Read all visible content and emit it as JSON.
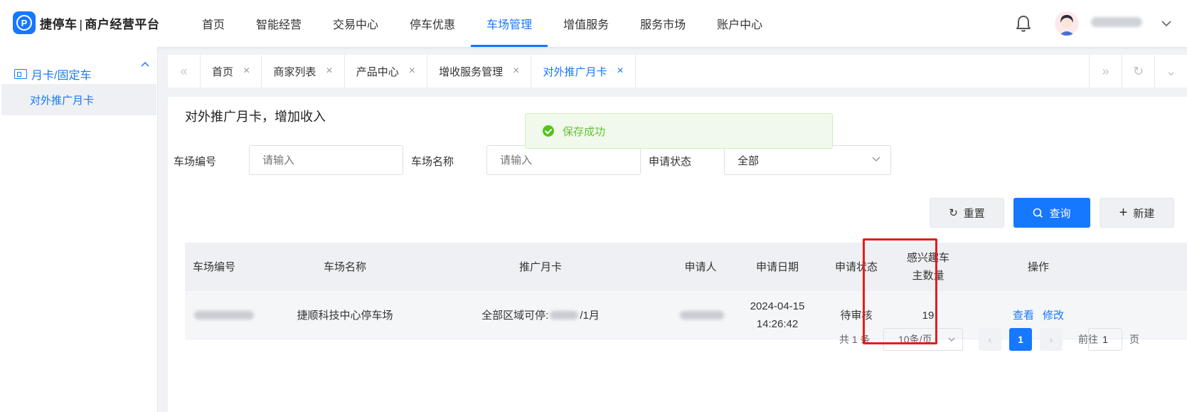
{
  "app": {
    "name": "捷停车",
    "subtitle": "商户经营平台",
    "separator": "|"
  },
  "nav": [
    {
      "label": "首页"
    },
    {
      "label": "智能经营"
    },
    {
      "label": "交易中心"
    },
    {
      "label": "停车优惠"
    },
    {
      "label": "车场管理",
      "active": true
    },
    {
      "label": "增值服务"
    },
    {
      "label": "服务市场"
    },
    {
      "label": "账户中心"
    }
  ],
  "sidebar": {
    "group": {
      "label": "月卡/固定车",
      "icon": "card-icon"
    },
    "items": [
      {
        "label": "对外推广月卡",
        "active": true
      }
    ]
  },
  "tabs": [
    {
      "label": "首页"
    },
    {
      "label": "商家列表"
    },
    {
      "label": "产品中心"
    },
    {
      "label": "增收服务管理"
    },
    {
      "label": "对外推广月卡",
      "active": true
    }
  ],
  "tab_close_glyph": "×",
  "toast": {
    "message": "保存成功",
    "type": "success",
    "color": "#67c23a"
  },
  "page": {
    "title": "对外推广月卡，增加收入"
  },
  "filters": {
    "park_code": {
      "label": "车场编号",
      "placeholder": "请输入"
    },
    "park_name": {
      "label": "车场名称",
      "placeholder": "请输入"
    },
    "status": {
      "label": "申请状态",
      "value": "全部"
    }
  },
  "buttons": {
    "reset": "重置",
    "query": "查询",
    "create": "新建"
  },
  "table": {
    "headers": [
      "车场编号",
      "车场名称",
      "推广月卡",
      "申请人",
      "申请日期",
      "申请状态",
      "感兴趣车主数量",
      "操作"
    ],
    "header_interest_lines": [
      "感兴趣车",
      "主数量"
    ],
    "rows": [
      {
        "park_name": "捷顺科技中心停车场",
        "card_prefix": "全部区域可停: ",
        "card_suffix": "/1月",
        "date": "2024-04-15",
        "time": "14:26:42",
        "status": "待审核",
        "interested": "19",
        "actions": [
          "查看",
          "修改"
        ]
      }
    ]
  },
  "pagination": {
    "total": "共 1 条",
    "page_size": "10条/页",
    "current": "1",
    "goto_label": "前往",
    "goto_value": "1",
    "page_unit": "页"
  },
  "colors": {
    "primary": "#1677ff",
    "highlight": "#e61c1c",
    "success": "#52c41a"
  }
}
